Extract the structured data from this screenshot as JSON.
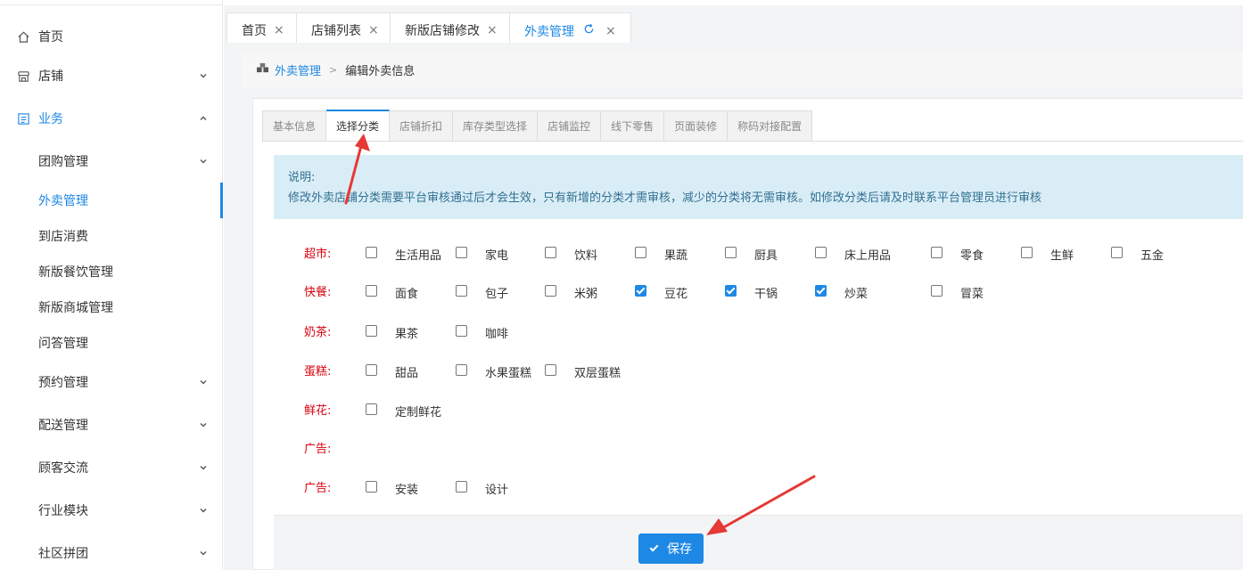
{
  "sidebar": {
    "items": [
      {
        "label": "首页",
        "icon": "home-icon"
      },
      {
        "label": "店铺",
        "icon": "store-icon"
      },
      {
        "label": "业务",
        "icon": "business-icon"
      },
      {
        "label": "团购管理"
      },
      {
        "label": "外卖管理"
      },
      {
        "label": "到店消费"
      },
      {
        "label": "新版餐饮管理"
      },
      {
        "label": "新版商城管理"
      },
      {
        "label": "问答管理"
      },
      {
        "label": "预约管理"
      },
      {
        "label": "配送管理"
      },
      {
        "label": "顾客交流"
      },
      {
        "label": "行业模块"
      },
      {
        "label": "社区拼团"
      }
    ]
  },
  "top_tabs": [
    {
      "label": "首页"
    },
    {
      "label": "店铺列表"
    },
    {
      "label": "新版店铺修改"
    },
    {
      "label": "外卖管理"
    }
  ],
  "breadcrumb": {
    "home": "外卖管理",
    "current": "编辑外卖信息"
  },
  "tabs": [
    "基本信息",
    "选择分类",
    "店铺折扣",
    "库存类型选择",
    "店铺监控",
    "线下零售",
    "页面装修",
    "称码对接配置"
  ],
  "info": {
    "title": "说明:",
    "text": "修改外卖店铺分类需要平台审核通过后才会生效，只有新增的分类才需审核，减少的分类将无需审核。如修改分类后请及时联系平台管理员进行审核"
  },
  "categories": [
    {
      "label": "超市:",
      "options": [
        {
          "text": "生活用品",
          "checked": false
        },
        {
          "text": "家电",
          "checked": false
        },
        {
          "text": "饮料",
          "checked": false
        },
        {
          "text": "果蔬",
          "checked": false
        },
        {
          "text": "厨具",
          "checked": false
        },
        {
          "text": "床上用品",
          "checked": false
        },
        {
          "text": "零食",
          "checked": false
        },
        {
          "text": "生鲜",
          "checked": false
        },
        {
          "text": "五金",
          "checked": false
        }
      ]
    },
    {
      "label": "快餐:",
      "options": [
        {
          "text": "面食",
          "checked": false
        },
        {
          "text": "包子",
          "checked": false
        },
        {
          "text": "米粥",
          "checked": false
        },
        {
          "text": "豆花",
          "checked": true
        },
        {
          "text": "干锅",
          "checked": true
        },
        {
          "text": "炒菜",
          "checked": true
        },
        {
          "text": "冒菜",
          "checked": false
        }
      ]
    },
    {
      "label": "奶茶:",
      "options": [
        {
          "text": "果茶",
          "checked": false
        },
        {
          "text": "咖啡",
          "checked": false
        }
      ]
    },
    {
      "label": "蛋糕:",
      "options": [
        {
          "text": "甜品",
          "checked": false
        },
        {
          "text": "水果蛋糕",
          "checked": false
        },
        {
          "text": "双层蛋糕",
          "checked": false
        }
      ]
    },
    {
      "label": "鲜花:",
      "options": [
        {
          "text": "定制鲜花",
          "checked": false
        }
      ]
    },
    {
      "label": "广告:",
      "options": []
    },
    {
      "label": "广告:",
      "options": [
        {
          "text": "安装",
          "checked": false
        },
        {
          "text": "设计",
          "checked": false
        }
      ]
    }
  ],
  "save_label": "保存",
  "colors": {
    "accent": "#1e88e5",
    "category_label": "#d9000c",
    "info_bg": "#d9edf7",
    "arrow": "#e53935"
  }
}
